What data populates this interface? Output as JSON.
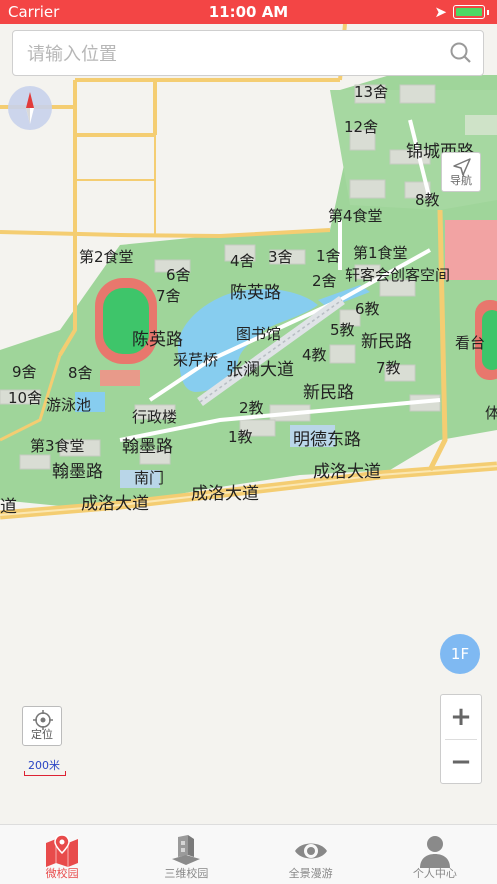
{
  "status_bar": {
    "carrier": "Carrier",
    "time": "11:00 AM"
  },
  "search": {
    "placeholder": "请输入位置"
  },
  "controls": {
    "nav_label": "导航",
    "floor_label": "1F",
    "zoom_in": "+",
    "zoom_out": "−",
    "locate_label": "定位",
    "scale_label": "200米"
  },
  "map_labels": {
    "l13she": "13舍",
    "l12she": "12舍",
    "jinchengxilu": "锦城西路",
    "l8jiao": "8教",
    "canteen4": "第4食堂",
    "canteen2": "第2食堂",
    "l4she": "4舍",
    "l3she": "3舍",
    "l1she": "1舍",
    "canteen1": "第1食堂",
    "l6she": "6舍",
    "l7she": "7舍",
    "chenyinglu1": "陈英路",
    "l2she": "2舍",
    "xuanke": "轩客会创客空间",
    "l6jiao": "6教",
    "library": "图书馆",
    "l5jiao": "5教",
    "xinminlu1": "新民路",
    "kantai": "看台",
    "chenyinglu2": "陈英路",
    "caiqinqiao": "采芹桥",
    "zhanglan": "张澜大道",
    "l4jiao": "4教",
    "l7jiao": "7教",
    "l9she": "9舍",
    "l8she": "8舍",
    "xinminlu2": "新民路",
    "l10she": "10舍",
    "pool": "游泳池",
    "admin": "行政楼",
    "l2jiao": "2教",
    "ti": "体",
    "canteen3": "第3食堂",
    "hanmolu1": "翰墨路",
    "l1jiao": "1教",
    "mingde": "明德东路",
    "hanmolu2": "翰墨路",
    "nanmen": "南门",
    "chengluo1": "成洛大道",
    "dao": "道",
    "chengluo2": "成洛大道",
    "chengluo3": "成洛大道"
  },
  "tabs": [
    {
      "label": "微校园",
      "icon": "map-icon",
      "active": true
    },
    {
      "label": "三维校园",
      "icon": "3d-building-icon",
      "active": false
    },
    {
      "label": "全景漫游",
      "icon": "eye-icon",
      "active": false
    },
    {
      "label": "个人中心",
      "icon": "person-icon",
      "active": false
    }
  ],
  "colors": {
    "accent": "#f34545",
    "green": "#8fd28f",
    "water": "#87cdef",
    "road": "#f4cd72",
    "floor_button": "#7fb9f2"
  }
}
